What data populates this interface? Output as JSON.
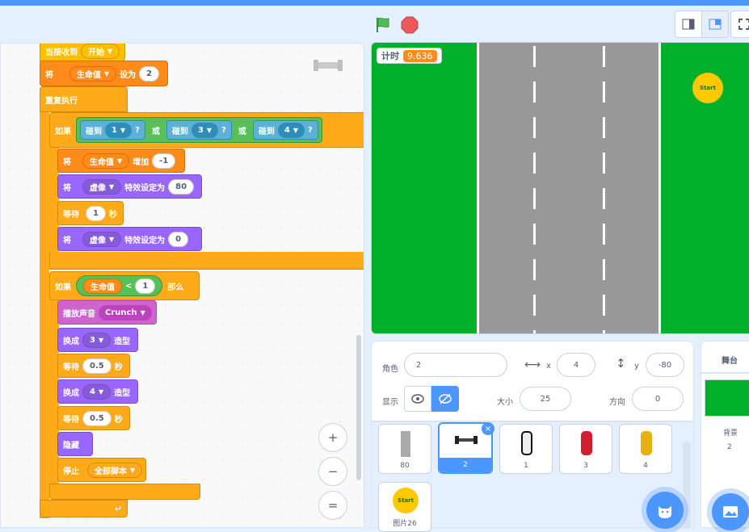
{
  "header": {
    "green_flag_icon": "green-flag-icon",
    "stop_icon": "stop-icon",
    "small_stage_label": "small-stage-icon",
    "normal_stage_label": "normal-stage-icon",
    "fullscreen_label": "fullscreen-icon"
  },
  "script": {
    "hat_label": "当接收到",
    "hat_message": "开始",
    "set_label": "将",
    "set_var": "生命值",
    "set_to": "设为",
    "set_value": "2",
    "forever": "重复执行",
    "if1": "如果",
    "touching": "碰到",
    "touch1": "1",
    "touch3": "3",
    "touch4": "4",
    "q": "?",
    "or": "或",
    "change_label": "将",
    "change_var": "生命值",
    "change_by": "增加",
    "change_value": "-1",
    "effect1_label": "将",
    "effect1_name": "虚像",
    "effect1_to": "特效设定为",
    "effect1_value": "80",
    "wait1_label": "等待",
    "wait1_value": "1",
    "wait1_unit": "秒",
    "effect2_label": "将",
    "effect2_name": "虚像",
    "effect2_to": "特效设定为",
    "effect2_value": "0",
    "if2": "如果",
    "if2_var": "生命值",
    "lt": "<",
    "if2_value": "1",
    "then": "那么",
    "play_label": "播放声音",
    "play_sound": "Crunch",
    "switch1_label": "换成",
    "switch1_value": "3",
    "switch1_unit": "造型",
    "wait2_label": "等待",
    "wait2_value": "0.5",
    "wait2_unit": "秒",
    "switch2_label": "换成",
    "switch2_value": "4",
    "switch2_unit": "造型",
    "wait3_label": "等待",
    "wait3_value": "0.5",
    "wait3_unit": "秒",
    "hide": "隐藏",
    "stop_label": "停止",
    "stop_value": "全部脚本"
  },
  "zoom": {
    "in": "+",
    "out": "−",
    "reset": "="
  },
  "stage": {
    "timer_label": "计时",
    "timer_value": "9.636",
    "start_label": "Start"
  },
  "sprite_info": {
    "sprite_label": "角色",
    "sprite_name": "2",
    "x_label": "x",
    "x_value": "4",
    "y_label": "y",
    "y_value": "-80",
    "show_label": "显示",
    "size_label": "大小",
    "size_value": "25",
    "direction_label": "方向",
    "direction_value": "0"
  },
  "sprites": [
    {
      "name": "80"
    },
    {
      "name": "2"
    },
    {
      "name": "1"
    },
    {
      "name": "3"
    },
    {
      "name": "4"
    },
    {
      "name": "图片26"
    }
  ],
  "stage_pane": {
    "title": "舞台",
    "backdrops_label": "背景",
    "backdrops_count": "2"
  },
  "colors": {
    "accent": "#4c97ff",
    "stage_green": "#00b02b",
    "road_gray": "#999999"
  }
}
